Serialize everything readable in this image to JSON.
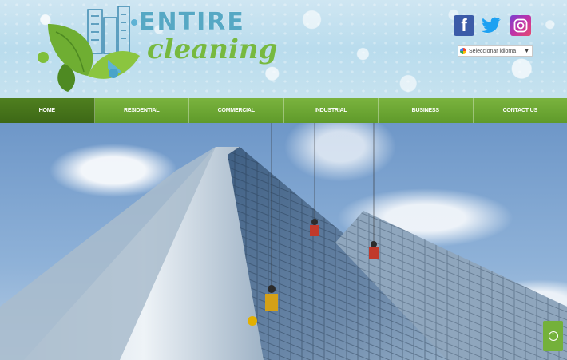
{
  "brand": {
    "line1": "ENTIRE",
    "line2": "cleaning"
  },
  "social": {
    "facebook_glyph": "f",
    "facebook_icon": "facebook-icon",
    "twitter_icon": "twitter-icon",
    "instagram_icon": "instagram-icon"
  },
  "translate": {
    "label": "Seleccionar idioma",
    "arrow": "▼"
  },
  "nav": {
    "items": [
      {
        "label": "HOME"
      },
      {
        "label": "RESIDENTIAL"
      },
      {
        "label": "COMMERCIAL"
      },
      {
        "label": "INDUSTRIAL"
      },
      {
        "label": "BUSINESS"
      },
      {
        "label": "CONTACT US"
      }
    ],
    "active_index": 0
  },
  "colors": {
    "brand_green": "#74b13a",
    "brand_blue": "#56a8c4"
  },
  "scroll_top": {
    "icon": "chevron-up-icon",
    "glyph": "⌃"
  }
}
